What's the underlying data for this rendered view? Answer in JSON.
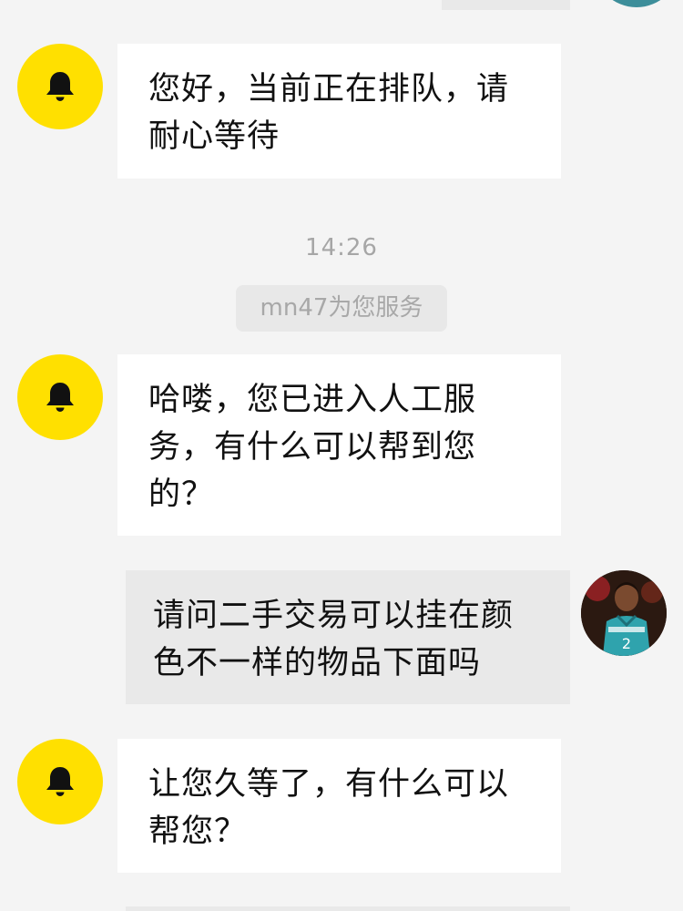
{
  "messages": [
    {
      "sender": "agent",
      "avatar_icon": "bell-icon",
      "text": "您好，当前正在排队，请耐心等待"
    },
    {
      "sender": "agent",
      "avatar_icon": "bell-icon",
      "text": "哈喽，您已进入人工服务，有什么可以帮到您的？"
    },
    {
      "sender": "user",
      "text": "请问二手交易可以挂在颜色不一样的物品下面吗"
    },
    {
      "sender": "agent",
      "avatar_icon": "bell-icon",
      "text": "让您久等了，有什么可以帮您？"
    }
  ],
  "timestamp": "14:26",
  "system_notice": "mn47为您服务",
  "colors": {
    "background": "#f4f4f4",
    "agent_avatar": "#ffe000",
    "agent_bubble": "#ffffff",
    "user_bubble": "#e9e9e9"
  }
}
